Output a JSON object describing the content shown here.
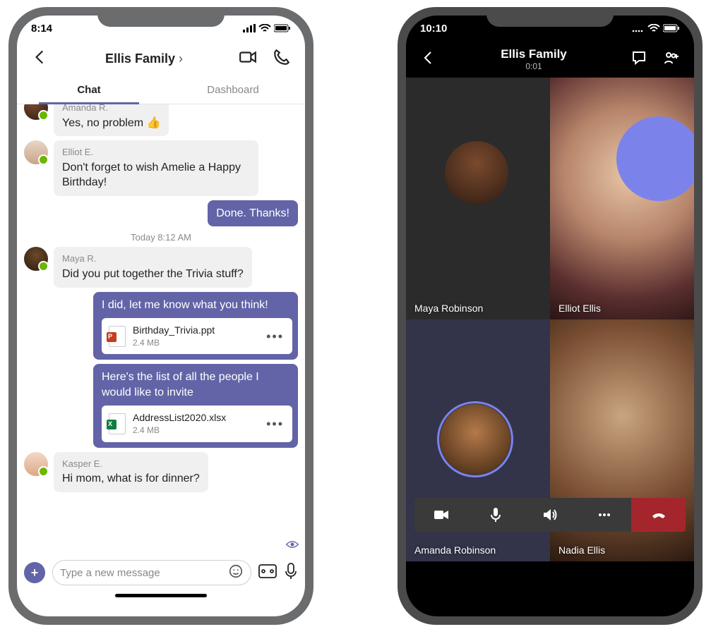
{
  "left": {
    "status_time": "8:14",
    "header": {
      "title": "Ellis Family",
      "chevron": "›"
    },
    "tabs": {
      "chat": "Chat",
      "dashboard": "Dashboard"
    },
    "messages": {
      "m0": {
        "sender": "Amanda R.",
        "text": "Yes, no problem 👍"
      },
      "m1": {
        "sender": "Elliot E.",
        "text": "Don't forget to wish Amelie a Happy Birthday!"
      },
      "m2": {
        "text": "Done. Thanks!"
      },
      "ts": "Today 8:12 AM",
      "m3": {
        "sender": "Maya R.",
        "text": "Did you put together the Trivia stuff?"
      },
      "m4": {
        "text": "I did, let me know what you think!",
        "file": {
          "name": "Birthday_Trivia.ppt",
          "size": "2.4 MB"
        }
      },
      "m5": {
        "text": "Here's the list of all the people I would like to invite",
        "file": {
          "name": "AddressList2020.xlsx",
          "size": "2.4 MB"
        }
      },
      "m6": {
        "sender": "Kasper E.",
        "text": "Hi mom, what is for dinner?"
      }
    },
    "composer": {
      "placeholder": "Type a new message"
    }
  },
  "right": {
    "status_time": "10:10",
    "header": {
      "title": "Ellis Family",
      "duration": "0:01"
    },
    "participants": {
      "p1": "Maya Robinson",
      "p2": "Elliot Ellis",
      "p3": "Amanda Robinson",
      "p4": "Nadia Ellis"
    }
  },
  "colors": {
    "accent": "#6264A7",
    "hangup": "#a4262c"
  }
}
